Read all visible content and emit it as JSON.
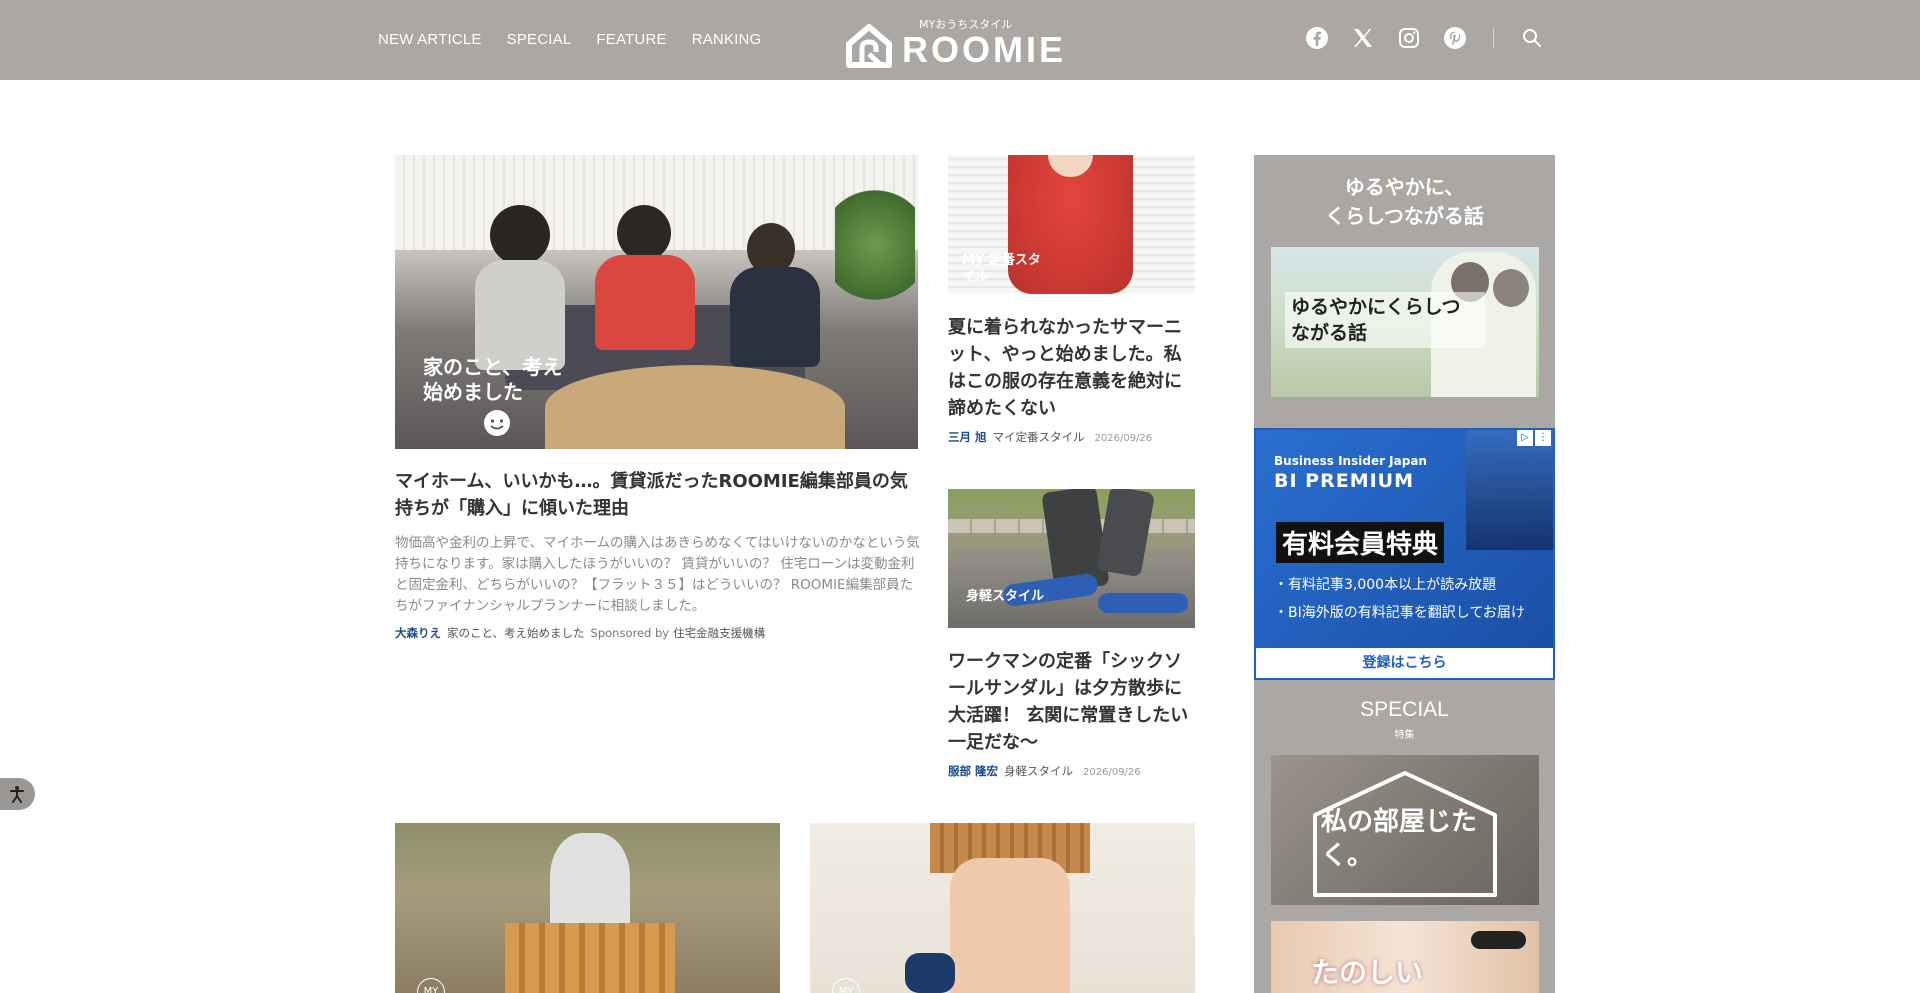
{
  "header": {
    "nav": [
      "NEW ARTICLE",
      "SPECIAL",
      "FEATURE",
      "RANKING"
    ],
    "logo_tagline": "MYおうちスタイル",
    "logo_text": "ROOMIE",
    "social_icons": [
      "facebook-icon",
      "x-icon",
      "instagram-icon",
      "pinterest-icon"
    ],
    "search_icon": "search-icon",
    "bg_color": "#aaa7a5"
  },
  "main": {
    "feature": {
      "image_overlay": "家のこと、考え始めました",
      "title": "マイホーム、いいかも…。賃貸派だったROOMIE編集部員の気持ちが「購入」に傾いた理由",
      "description": "物価高や金利の上昇で、マイホームの購入はあきらめなくてはいけないのかなという気持ちになります。家は購入したほうがいいの？ 賃貸がいいの？ 住宅ローンは変動金利と固定金利、どちらがいいの？【フラット３５】はどういいの？ ROOMIE編集部員たちがファイナンシャルプランナーに相談しました。",
      "author": "大森りえ",
      "category": "家のこと、考え始めました",
      "sponsored_label": "Sponsored by",
      "sponsor": "住宅金融支援機構"
    },
    "side_articles": [
      {
        "image_overlay": "MY 定番スタイル",
        "title": "夏に着られなかったサマーニット、やっと始めました。私はこの服の存在意義を絶対に諦めたくない",
        "author": "三月 旭",
        "category": "マイ定番スタイル",
        "date": "2026/09/26"
      },
      {
        "image_overlay": "身軽スタイル",
        "title": "ワークマンの定番「シックソールサンダル」は夕方散歩に大活躍！ 玄関に常置きしたい一足だな〜",
        "author": "服部 隆宏",
        "category": "身軽スタイル",
        "date": "2026/09/26"
      }
    ],
    "bottom_badges": [
      "MY",
      "MY"
    ]
  },
  "sidebar": {
    "heading_line1": "ゆるやかに、",
    "heading_line2": "くらしつながる話",
    "banner1_text": "ゆるやかにくらしつながる話",
    "ad": {
      "brand": "Business Insider Japan",
      "name": "BI PREMIUM",
      "badge": "有料会員特典",
      "point1": "・有料記事3,000本以上が読み放題",
      "point2": "・BI海外版の有料記事を翻訳してお届け",
      "cta": "登録はこちら"
    },
    "special_title": "SPECIAL",
    "special_sub": "特集",
    "banner2_text": "私の部屋じたく。",
    "banner3_text": "たのしい"
  }
}
